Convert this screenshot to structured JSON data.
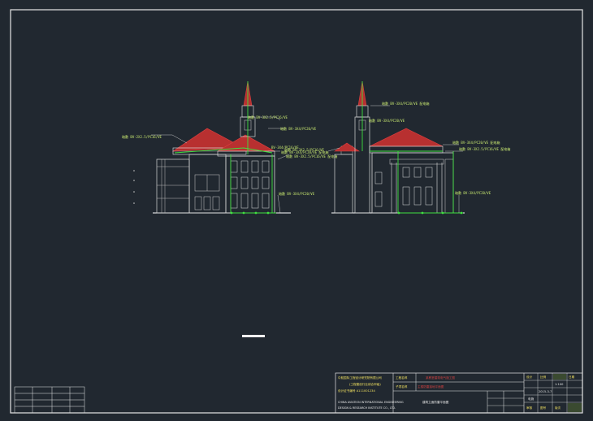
{
  "drawing": {
    "background": "#212830",
    "frame_color": "#e6e6e6",
    "west_elevation_annotations": [
      "暗敷 BV-2X2.5/PC16/VE",
      "暗敷 BV-3X2.5/PC16/VE",
      "暗敷 BV-3X4/PC20/VE",
      "BV-3X4/PC16/VE",
      "暗敷 BV-3X4/PC20/VE 配电箱",
      "暗敷 BV-3X2.5/PC16/VE 配电箱",
      "暗敷 BV-3X4/PC20/VE"
    ],
    "east_elevation_annotations": [
      "暗敷 BV-3X4/PC20/VE 配电箱",
      "暗敷 BV-3X4/PC20/VE",
      "暗敷 BV-3X2.5/PC16/VE",
      "暗敷 BV-3X4/PC20/VE 配电箱",
      "暗敷 BV-3X2.5/PC16/VE 配电箱",
      "暗敷 BV-3X4/PC20/VE"
    ],
    "scale_bar_label": ""
  },
  "title_block": {
    "company_cn": "中航国际工程设计研究院有限公司",
    "company_sub": "(工程建设行业综合甲级)",
    "license": "设计证书编号 A111001234",
    "company_en_1": "CHINA AVIATION INTERNATIONAL ENGINEERING",
    "company_en_2": "DESIGN & RESEARCH INSTITUTE CO., LTD.",
    "project_label": "工程名称",
    "project_value": "某教堂建筑电气施工图",
    "subitem_label": "子项名称",
    "subitem_value": "主楼防雷接地平面图",
    "drawing_title": "建筑立面防雷平面图",
    "meta_top": [
      "设计",
      "比例",
      "日期"
    ],
    "meta_values": [
      "1:100",
      "2015-3-7",
      "电施"
    ],
    "meta_bottom": [
      "审核",
      "图号",
      "版次"
    ],
    "left_small_block": [
      "",
      "",
      "",
      ""
    ]
  }
}
